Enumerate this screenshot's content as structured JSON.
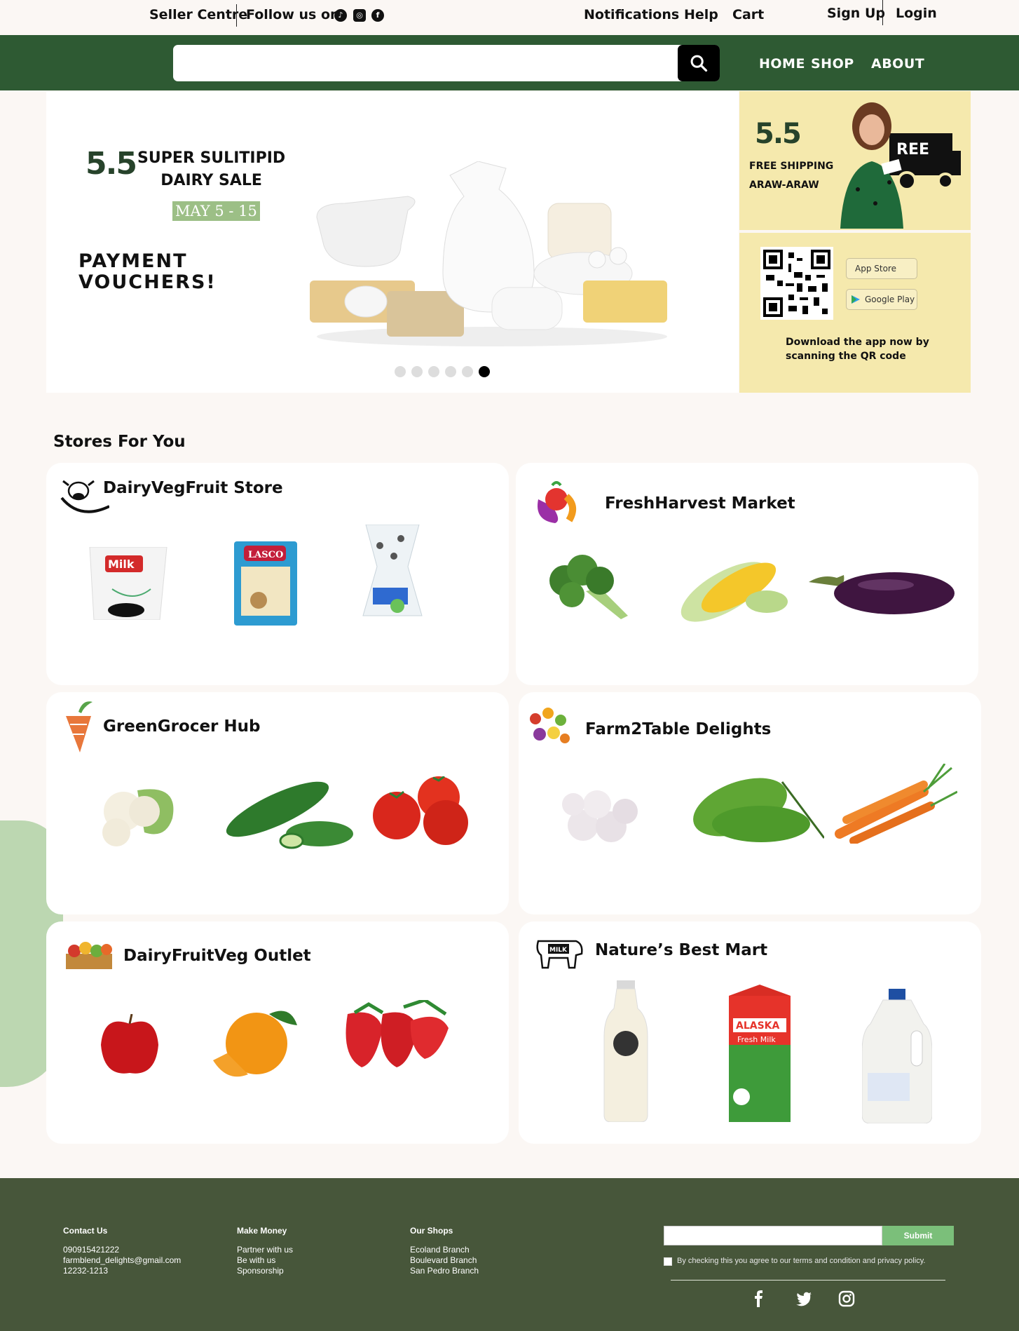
{
  "topbar": {
    "seller": "Seller Centre",
    "follow": "Follow us on",
    "notifications": "Notifications",
    "help": "Help",
    "cart": "Cart",
    "signup": "Sign Up",
    "login": "Login",
    "socials": [
      "tiktok-icon",
      "instagram-icon",
      "facebook-icon"
    ]
  },
  "search": {
    "placeholder": ""
  },
  "nav": {
    "home": "HOME",
    "shop": "SHOP",
    "about": "ABOUT"
  },
  "hero": {
    "badge": "5.5",
    "line1": "SUPER SULITIPID",
    "line2": "DAIRY SALE",
    "date": "MAY 5 - 15",
    "pay1": "PAYMENT",
    "pay2": "VOUCHERS!",
    "slides": 6,
    "active_slide": 6
  },
  "promo": {
    "badge": "5.5",
    "ship1": "FREE SHIPPING",
    "ship2": "ARAW-ARAW",
    "appstore": "App Store",
    "googleplay": "Google Play",
    "dl1": "Download the app now by",
    "dl2": "scanning the QR code"
  },
  "stores_title": "Stores For You",
  "stores": [
    {
      "name": "DairyVegFruit Store"
    },
    {
      "name": "FreshHarvest Market"
    },
    {
      "name": "GreenGrocer Hub"
    },
    {
      "name": "Farm2Table Delights"
    },
    {
      "name": "DairyFruitVeg Outlet"
    },
    {
      "name": "Nature’s Best Mart"
    }
  ],
  "footer": {
    "contact_title": "Contact Us",
    "contact": [
      "090915421222",
      "farmblend_delights@gmail.com",
      "12232-1213"
    ],
    "money_title": "Make Money",
    "money": [
      "Partner with us",
      "Be with us",
      "Sponsorship"
    ],
    "shops_title": "Our Shops",
    "shops": [
      "Ecoland Branch",
      "Boulevard Branch",
      "San Pedro Branch"
    ],
    "submit": "Submit",
    "terms": "By checking this you agree to our terms and condition and privacy policy.",
    "social": [
      "facebook-icon",
      "twitter-icon",
      "instagram-icon"
    ]
  },
  "colors": {
    "nav_green": "#2e5a33",
    "footer_green": "#47563a",
    "promo_yellow": "#f5e9ad",
    "submit_green": "#7bbf7a"
  }
}
